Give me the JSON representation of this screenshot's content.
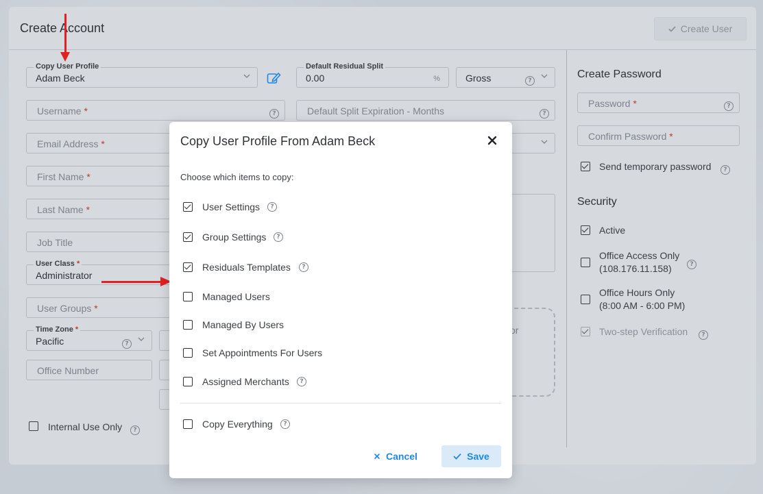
{
  "header": {
    "title": "Create Account",
    "create_user_label": "Create User"
  },
  "form": {
    "copy_profile": {
      "legend": "Copy User Profile",
      "value": "Adam Beck"
    },
    "residual_split": {
      "legend": "Default Residual Split",
      "value": "0.00",
      "unit": "%",
      "type_value": "Gross"
    },
    "username": {
      "placeholder": "Username",
      "required": "*"
    },
    "split_expiration": {
      "placeholder": "Default Split Expiration - Months"
    },
    "email": {
      "placeholder": "Email Address",
      "required": "*"
    },
    "first_name": {
      "placeholder": "First Name",
      "required": "*"
    },
    "last_name": {
      "placeholder": "Last Name",
      "required": "*"
    },
    "job_title": {
      "placeholder": "Job Title"
    },
    "user_class": {
      "legend": "User Class",
      "required": "*",
      "value": "Administrator"
    },
    "user_groups": {
      "placeholder": "User Groups",
      "required": "*"
    },
    "time_zone": {
      "legend": "Time Zone",
      "required": "*",
      "value": "Pacific"
    },
    "office_number": {
      "placeholder": "Office Number"
    },
    "dropzone_fragment": "or",
    "internal_use": {
      "label": "Internal Use Only",
      "checked": false
    }
  },
  "password": {
    "section_title": "Create Password",
    "password_placeholder": "Password",
    "confirm_placeholder": "Confirm Password",
    "required": "*",
    "send_temp": {
      "label": "Send temporary password",
      "checked": true
    }
  },
  "security": {
    "section_title": "Security",
    "active": {
      "label": "Active",
      "checked": true
    },
    "office_access": {
      "line1": "Office Access Only",
      "line2": "(108.176.11.158)",
      "checked": false
    },
    "office_hours": {
      "line1": "Office Hours Only",
      "line2": "(8:00 AM - 6:00 PM)",
      "checked": false
    },
    "two_step": {
      "label": "Two-step Verification",
      "checked": true,
      "disabled": true
    }
  },
  "modal": {
    "title": "Copy User Profile From Adam Beck",
    "subtitle": "Choose which items to copy:",
    "options": [
      {
        "label": "User Settings",
        "checked": true,
        "help": true
      },
      {
        "label": "Group Settings",
        "checked": true,
        "help": true
      },
      {
        "label": "Residuals Templates",
        "checked": true,
        "help": true
      },
      {
        "label": "Managed Users",
        "checked": false,
        "help": false
      },
      {
        "label": "Managed By Users",
        "checked": false,
        "help": false
      },
      {
        "label": "Set Appointments For Users",
        "checked": false,
        "help": false
      },
      {
        "label": "Assigned Merchants",
        "checked": false,
        "help": true
      }
    ],
    "copy_everything": {
      "label": "Copy Everything",
      "checked": false
    },
    "cancel_label": "Cancel",
    "save_label": "Save"
  },
  "colors": {
    "accent": "#1e88e5",
    "annotation_arrow": "#e02222",
    "required": "#c0392b"
  }
}
